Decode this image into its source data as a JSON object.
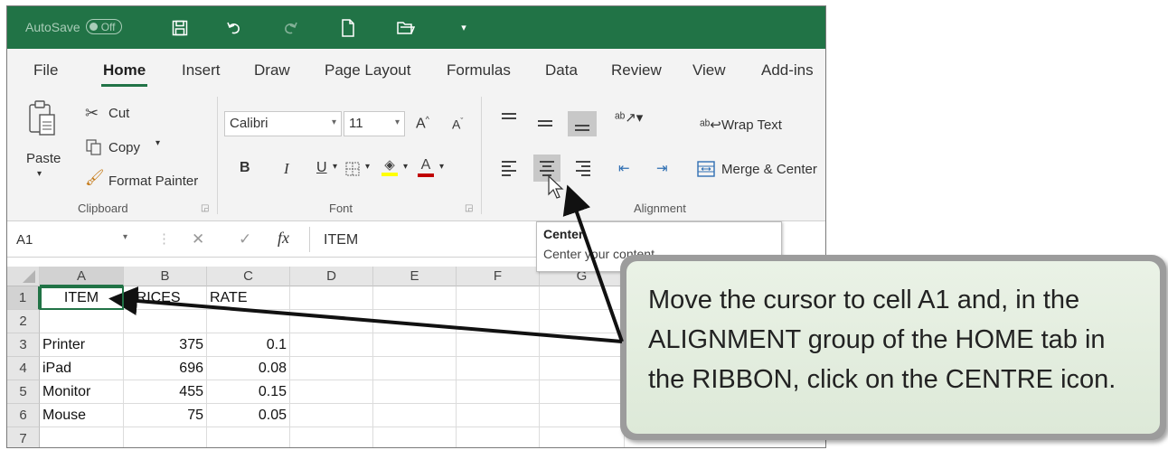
{
  "titlebar": {
    "autosave_label": "AutoSave",
    "autosave_state": "Off",
    "icons": [
      "save-icon",
      "undo-icon",
      "redo-icon",
      "new-file-icon",
      "open-folder-icon",
      "customize-dropdown-icon"
    ]
  },
  "tabs": [
    "File",
    "Home",
    "Insert",
    "Draw",
    "Page Layout",
    "Formulas",
    "Data",
    "Review",
    "View",
    "Add-ins"
  ],
  "active_tab": "Home",
  "clipboard": {
    "paste": "Paste",
    "cut": "Cut",
    "copy": "Copy",
    "format_painter": "Format Painter",
    "label": "Clipboard"
  },
  "font": {
    "name": "Calibri",
    "size": "11",
    "bold": "B",
    "italic": "I",
    "underline": "U",
    "font_color_glyph": "A",
    "grow": "A",
    "shrink": "A",
    "label": "Font"
  },
  "alignment": {
    "wrap_text": "Wrap Text",
    "merge_center": "Merge & Center",
    "label": "Alignment"
  },
  "formula_bar": {
    "name_box": "A1",
    "fx": "fx",
    "content": "ITEM"
  },
  "tooltip": {
    "title": "Center",
    "description": "Center your content."
  },
  "sheet": {
    "columns": [
      "A",
      "B",
      "C",
      "D",
      "E",
      "F",
      "G"
    ],
    "rows": [
      "1",
      "2",
      "3",
      "4",
      "5",
      "6",
      "7"
    ],
    "header": [
      "ITEM",
      "PRICES",
      "RATE"
    ],
    "data": [
      [
        "Printer",
        "375",
        "0.1"
      ],
      [
        "iPad",
        "696",
        "0.08"
      ],
      [
        "Monitor",
        "455",
        "0.15"
      ],
      [
        "Mouse",
        "75",
        "0.05"
      ]
    ]
  },
  "callout": {
    "text": "Move the cursor to cell A1 and, in the ALIGNMENT group of the HOME tab in the RIBBON, click on the CENTRE icon."
  },
  "colors": {
    "excel_green": "#217346",
    "ribbon_bg": "#f3f3f3",
    "callout_bg": "#e4eedf",
    "font_color_bar": "#c00000",
    "highlight_bar": "#ffff00"
  }
}
